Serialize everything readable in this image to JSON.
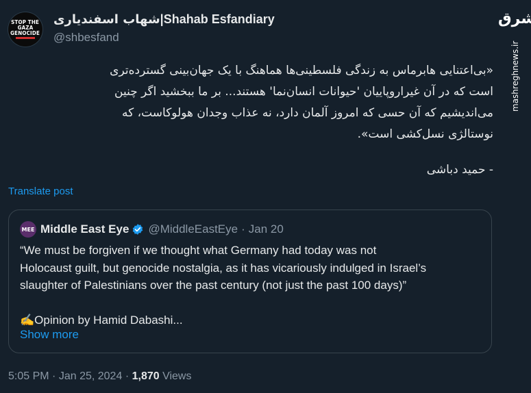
{
  "author": {
    "avatar_lines": [
      "STOP THE",
      "GAZA",
      "GENOCIDE"
    ],
    "name_fa": "شهاب اسفندیاری",
    "name_sep": "|",
    "name_en": "Shahab Esfandiary",
    "handle": "@shbesfand"
  },
  "watermark": {
    "logo_text": "مشرق",
    "url": "mashreghnews.ir"
  },
  "post": {
    "lines": [
      "«بی‌اعتنایی هابرماس به زندگی فلسطینی‌ها هماهنگ با یک جهان‌بینی گسترده‌تری",
      "است که در آن غیراروپاییان 'حیوانات انسان‌نما' هستند... بر ما ببخشید اگر چنین",
      "می‌اندیشیم که آن حسی که امروز آلمان دارد، نه عذاب وجدان هولوکاست، که",
      "نوستالژی نسل‌کشی است»."
    ],
    "signature": "- حمید دباشی",
    "translate_label": "Translate post"
  },
  "quoted": {
    "avatar_text": "MEE",
    "name": "Middle East Eye",
    "handle": "@MiddleEastEye",
    "separator": "·",
    "date": "Jan 20",
    "lines": [
      "“We must be forgiven if we thought what Germany had today was not",
      "Holocaust guilt, but genocide nostalgia, as it has vicariously indulged in Israel’s",
      "slaughter of Palestinians over the past century (not just the past 100 days)”"
    ],
    "opinion_line": "✍️Opinion by Hamid Dabashi...",
    "show_more": "Show more"
  },
  "meta": {
    "time": "5:05 PM",
    "separator": "·",
    "date": "Jan 25, 2024",
    "views_count": "1,870",
    "views_label": "Views"
  },
  "colors": {
    "background": "#15202b",
    "link": "#1d9bf0",
    "secondary": "#8b98a5",
    "verified": "#1d9bf0"
  }
}
